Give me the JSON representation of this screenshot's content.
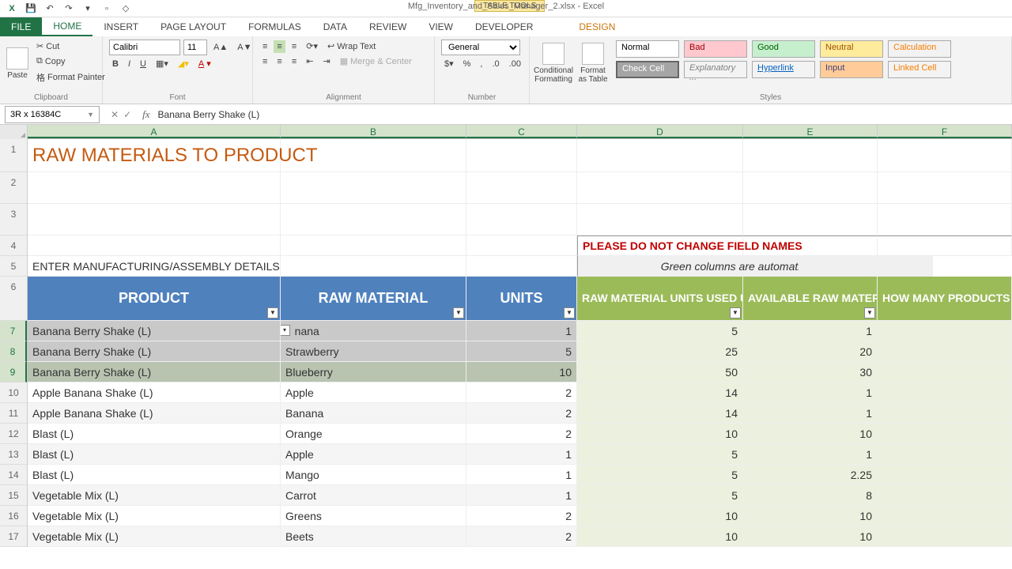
{
  "titlebar": {
    "filename": "Mfg_Inventory_and_Sales_Manager_2.xlsx - Excel",
    "tabtools": "TABLE TOOLS"
  },
  "tabs": {
    "file": "FILE",
    "home": "HOME",
    "insert": "INSERT",
    "pagelayout": "PAGE LAYOUT",
    "formulas": "FORMULAS",
    "data": "DATA",
    "review": "REVIEW",
    "view": "VIEW",
    "developer": "DEVELOPER",
    "design": "DESIGN"
  },
  "ribbon": {
    "clipboard": {
      "label": "Clipboard",
      "paste": "Paste",
      "cut": "Cut",
      "copy": "Copy",
      "format_painter": "Format Painter"
    },
    "font": {
      "label": "Font",
      "name": "Calibri",
      "size": "11"
    },
    "alignment": {
      "label": "Alignment",
      "wrap": "Wrap Text",
      "merge": "Merge & Center"
    },
    "number": {
      "label": "Number",
      "format": "General"
    },
    "cond": "Conditional Formatting",
    "fat": "Format as Table",
    "styles": {
      "label": "Styles",
      "normal": "Normal",
      "bad": "Bad",
      "good": "Good",
      "neutral": "Neutral",
      "calculation": "Calculation",
      "check": "Check Cell",
      "explanatory": "Explanatory ...",
      "hyperlink": "Hyperlink",
      "input": "Input",
      "linked": "Linked Cell"
    }
  },
  "fbar": {
    "namebox": "3R x 16384C",
    "formula": "Banana Berry Shake (L)"
  },
  "columns": [
    "A",
    "B",
    "C",
    "D",
    "E",
    "F"
  ],
  "sheet": {
    "title": "RAW MATERIALS TO PRODUCT",
    "warn": "PLEASE DO NOT CHANGE FIELD NAMES",
    "enter": "ENTER MANUFACTURING/ASSEMBLY DETAILS",
    "autocalc": "Green columns are automatically calculated",
    "headers": {
      "product": "PRODUCT",
      "raw": "RAW MATERIAL",
      "units": "UNITS",
      "used": "RAW MATERIAL UNITS USED UNTIL NOW",
      "avail": "AVAILABLE RAW MATERIALS NOW",
      "howmany": "HOW MANY PRODUCTS CAN BE MADE?"
    },
    "rows": [
      {
        "n": 7,
        "product": "Banana Berry Shake (L)",
        "raw": "nana",
        "units": "1",
        "used": "5",
        "avail": "1",
        "how": ""
      },
      {
        "n": 8,
        "product": "Banana Berry Shake (L)",
        "raw": "Strawberry",
        "units": "5",
        "used": "25",
        "avail": "20",
        "how": ""
      },
      {
        "n": 9,
        "product": "Banana Berry Shake (L)",
        "raw": "Blueberry",
        "units": "10",
        "used": "50",
        "avail": "30",
        "how": ""
      },
      {
        "n": 10,
        "product": "Apple Banana Shake (L)",
        "raw": "Apple",
        "units": "2",
        "used": "14",
        "avail": "1",
        "how": ""
      },
      {
        "n": 11,
        "product": "Apple Banana Shake (L)",
        "raw": "Banana",
        "units": "2",
        "used": "14",
        "avail": "1",
        "how": ""
      },
      {
        "n": 12,
        "product": "Blast (L)",
        "raw": "Orange",
        "units": "2",
        "used": "10",
        "avail": "10",
        "how": ""
      },
      {
        "n": 13,
        "product": "Blast (L)",
        "raw": "Apple",
        "units": "1",
        "used": "5",
        "avail": "1",
        "how": ""
      },
      {
        "n": 14,
        "product": "Blast (L)",
        "raw": "Mango",
        "units": "1",
        "used": "5",
        "avail": "2.25",
        "how": ""
      },
      {
        "n": 15,
        "product": "Vegetable Mix (L)",
        "raw": "Carrot",
        "units": "1",
        "used": "5",
        "avail": "8",
        "how": ""
      },
      {
        "n": 16,
        "product": "Vegetable Mix (L)",
        "raw": "Greens",
        "units": "2",
        "used": "10",
        "avail": "10",
        "how": ""
      },
      {
        "n": 17,
        "product": "Vegetable Mix (L)",
        "raw": "Beets",
        "units": "2",
        "used": "10",
        "avail": "10",
        "how": ""
      }
    ]
  }
}
